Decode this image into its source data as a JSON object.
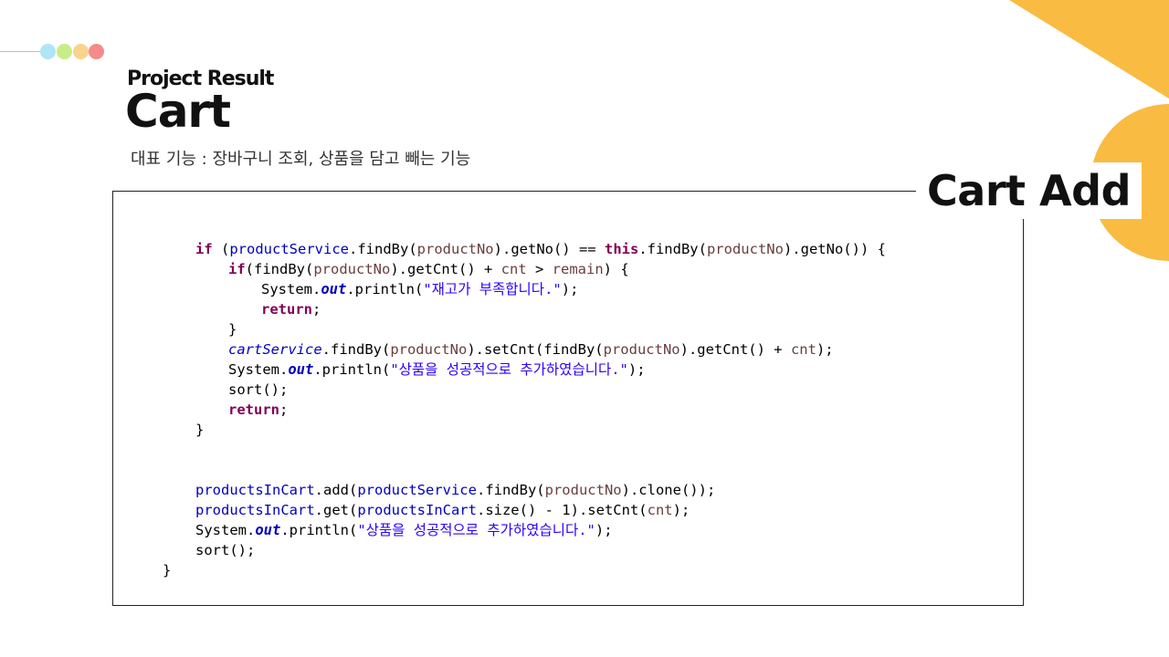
{
  "header": {
    "subtitle": "Project Result",
    "title": "Cart",
    "description": "대표 기능 : 장바구니 조회, 상품을 담고 빼는 기능"
  },
  "panel": {
    "heading": "Cart Add"
  },
  "code": {
    "productService": "productService",
    "productNo": "productNo",
    "this": "this",
    "if": "if",
    "cnt": "cnt",
    "remain": "remain",
    "out": "out",
    "msg_stock": "\"재고가 부족합니다.\"",
    "return": "return",
    "cartService": "cartService",
    "msg_added": "\"상품을 성공적으로 추가하였습니다.\"",
    "productsInCart": "productsInCart"
  },
  "colors": {
    "accent_yellow": "#f9bb42",
    "keyword": "#7f0055",
    "field": "#0000c0",
    "string": "#2a00ff",
    "variable": "#6a3e3e"
  }
}
